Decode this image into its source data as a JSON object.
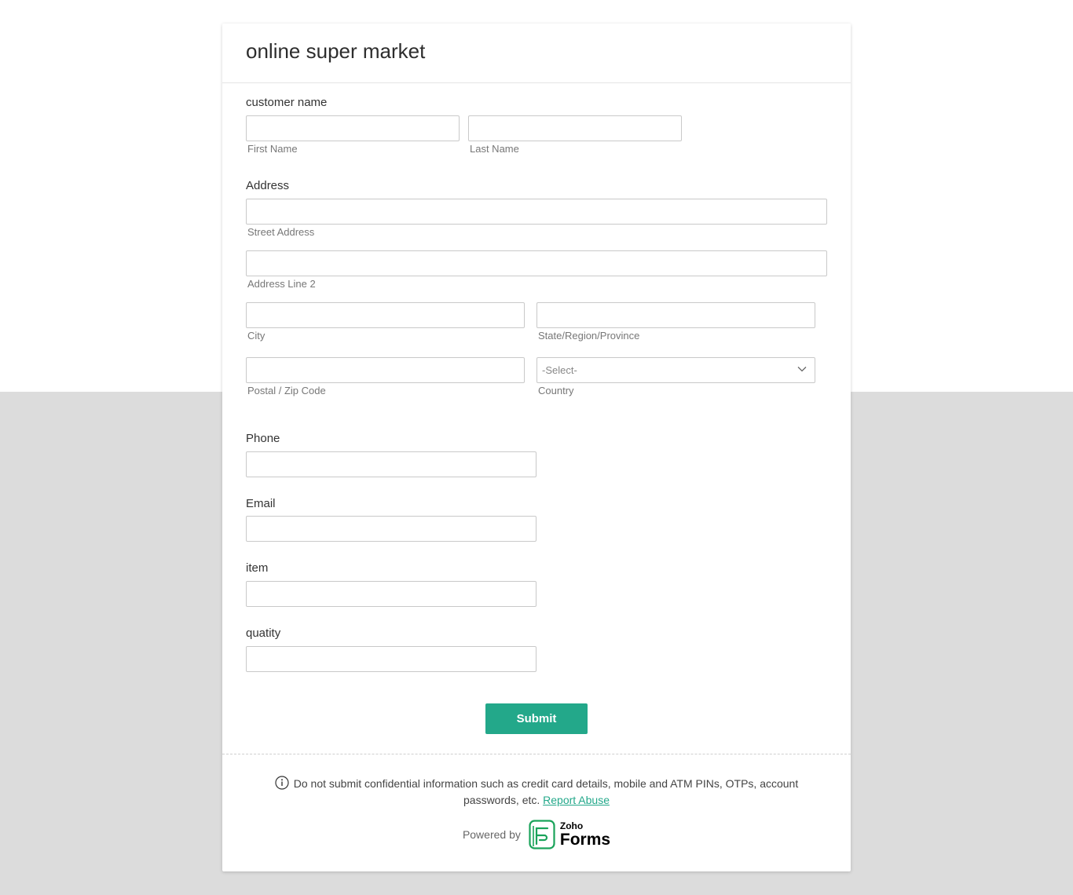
{
  "form": {
    "title": "online super market"
  },
  "customer_name": {
    "label": "customer name",
    "first_sublabel": "First Name",
    "last_sublabel": "Last Name",
    "first_value": "",
    "last_value": ""
  },
  "address": {
    "label": "Address",
    "street_sublabel": "Street Address",
    "line2_sublabel": "Address Line 2",
    "city_sublabel": "City",
    "state_sublabel": "State/Region/Province",
    "zip_sublabel": "Postal / Zip Code",
    "country_sublabel": "Country",
    "country_selected": "-Select-"
  },
  "phone": {
    "label": "Phone",
    "value": ""
  },
  "email": {
    "label": "Email",
    "value": ""
  },
  "item": {
    "label": "item",
    "value": ""
  },
  "quantity": {
    "label": "quatity",
    "value": ""
  },
  "submit_label": "Submit",
  "footer": {
    "notice": "Do not submit confidential information such as credit card details, mobile and ATM PINs, OTPs, account passwords, etc.",
    "report_link": "Report Abuse",
    "powered_by": "Powered by",
    "brand_small": "Zoho",
    "brand_big": "Forms"
  },
  "colors": {
    "accent": "#23a88a",
    "page_bottom": "#dcdcdc"
  },
  "icons": {
    "info": "info-circle-icon",
    "chevron": "chevron-down-icon",
    "logo": "zoho-forms-logo-icon"
  }
}
